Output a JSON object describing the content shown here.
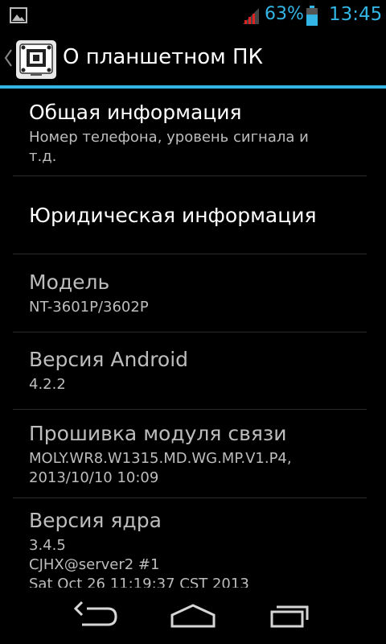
{
  "status_bar": {
    "left_icon": "image-notification-icon",
    "signal_icon": "signal-icon",
    "battery_percent": "63%",
    "battery_level": 0.63,
    "battery_icon": "battery-icon",
    "time": "13:45",
    "accent_color": "#33b5e5"
  },
  "action_bar": {
    "up_icon": "chevron-left-icon",
    "app_icon": "settings-app-icon",
    "title": "О планшетном ПК"
  },
  "items": [
    {
      "title": "Общая информация",
      "subtitle": "Номер телефона, уровень сигнала и\nт.д.",
      "enabled": true
    },
    {
      "title": "Юридическая информация",
      "subtitle": "",
      "enabled": true
    },
    {
      "title": "Модель",
      "subtitle": "NT-3601P/3602P",
      "enabled": false
    },
    {
      "title": "Версия Android",
      "subtitle": "4.2.2",
      "enabled": false
    },
    {
      "title": "Прошивка модуля связи",
      "subtitle": "MOLY.WR8.W1315.MD.WG.MP.V1.P4,\n2013/10/10 10:09",
      "enabled": false
    },
    {
      "title": "Версия ядра",
      "subtitle": "3.4.5\nCJHX@server2 #1\nSat Oct 26 11:19:37 CST 2013",
      "enabled": false
    }
  ],
  "nav_bar": {
    "back_icon": "back-icon",
    "home_icon": "home-icon",
    "recents_icon": "recents-icon"
  }
}
